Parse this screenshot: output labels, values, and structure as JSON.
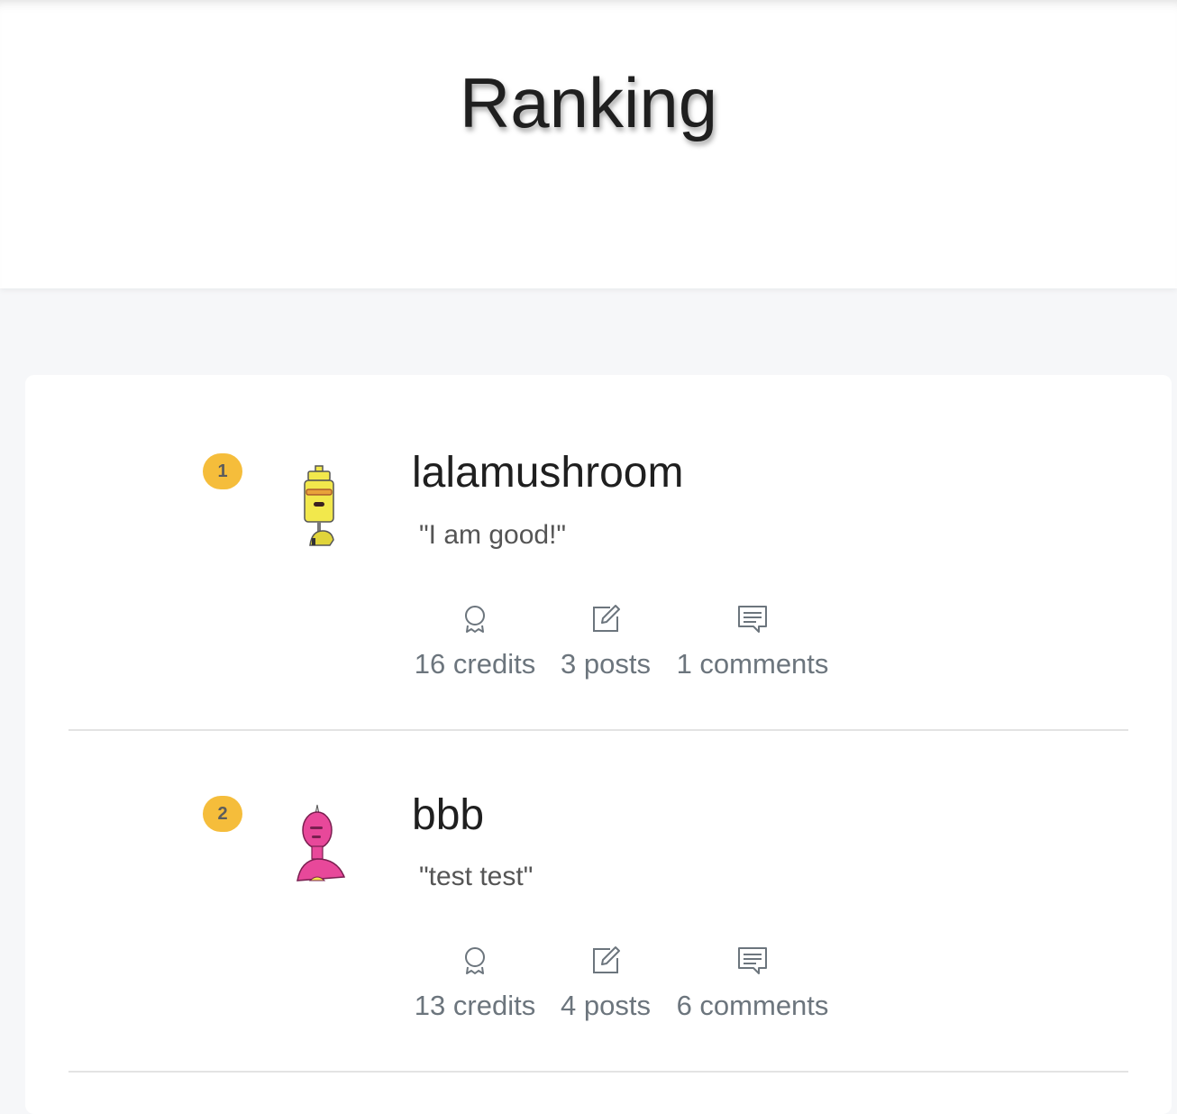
{
  "header": {
    "title": "Ranking"
  },
  "ranking": [
    {
      "rank": "1",
      "username": "lalamushroom",
      "motto": "\"I am good!\"",
      "avatar_color": "#f2e84c",
      "stats": {
        "credits": "16 credits",
        "posts": "3 posts",
        "comments": "1 comments"
      }
    },
    {
      "rank": "2",
      "username": "bbb",
      "motto": "\"test test\"",
      "avatar_color": "#e8489a",
      "stats": {
        "credits": "13 credits",
        "posts": "4 posts",
        "comments": "6 comments"
      }
    }
  ],
  "icons": {
    "credits": "award-icon",
    "posts": "edit-icon",
    "comments": "comment-icon"
  },
  "colors": {
    "rank_badge": "#f5bd3b",
    "stat_text": "#6c757d",
    "page_background": "#f6f7f9"
  }
}
